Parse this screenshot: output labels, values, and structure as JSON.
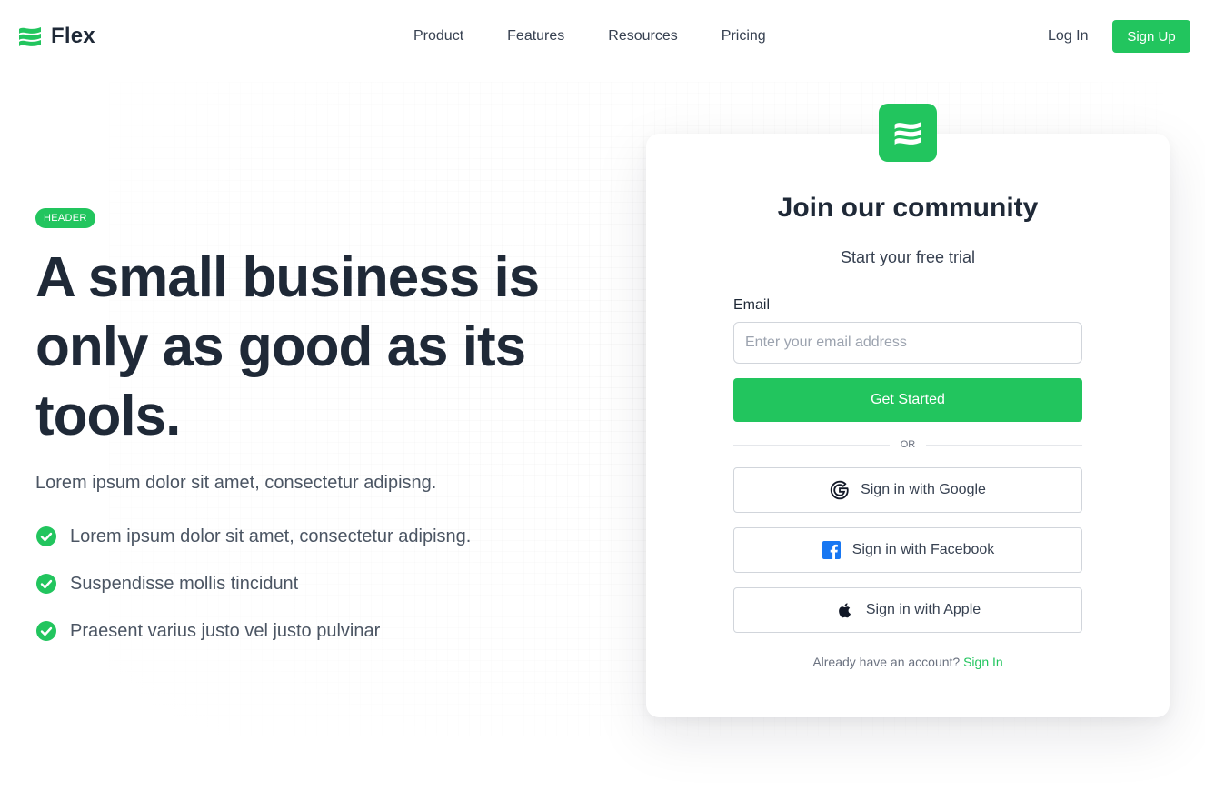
{
  "brand": {
    "name": "Flex",
    "accent_color": "#22c55e",
    "logo_icon": "flex-waves-icon"
  },
  "nav": {
    "items": [
      {
        "label": "Product"
      },
      {
        "label": "Features"
      },
      {
        "label": "Resources"
      },
      {
        "label": "Pricing"
      }
    ],
    "login_label": "Log In",
    "signup_label": "Sign Up"
  },
  "hero": {
    "badge": "HEADER",
    "headline": "A small business is only as good as its tools.",
    "subhead": "Lorem ipsum dolor sit amet, consectetur adipisng.",
    "features": [
      {
        "text": "Lorem ipsum dolor sit amet, consectetur adipisng.",
        "icon": "check-circle-icon"
      },
      {
        "text": "Suspendisse mollis tincidunt",
        "icon": "check-circle-icon"
      },
      {
        "text": "Praesent varius justo vel justo pulvinar",
        "icon": "check-circle-icon"
      }
    ]
  },
  "signup_card": {
    "title": "Join our community",
    "subtitle": "Start your free trial",
    "email_label": "Email",
    "email_placeholder": "Enter your email address",
    "email_value": "",
    "cta_label": "Get Started",
    "divider_text": "OR",
    "social": {
      "google_label": "Sign in with Google",
      "facebook_label": "Sign in with Facebook",
      "apple_label": "Sign in with Apple"
    },
    "footer_text": "Already have an account?",
    "footer_link": "Sign In"
  }
}
